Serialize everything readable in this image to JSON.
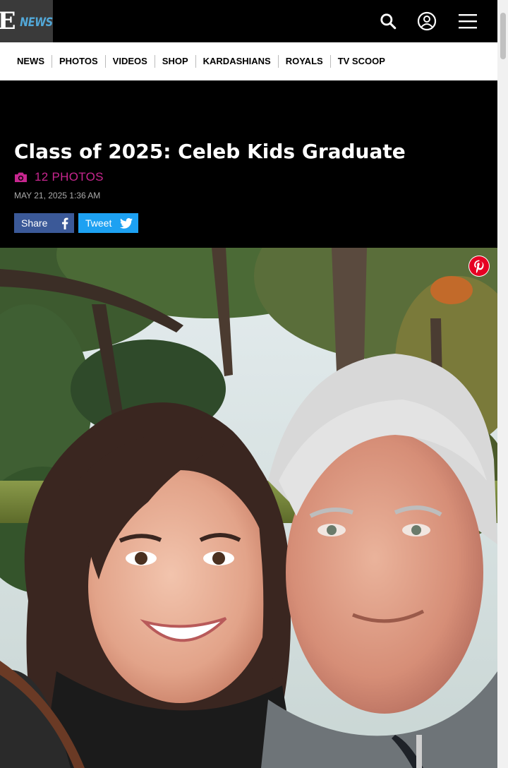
{
  "header": {
    "logo_e": "E",
    "logo_news": "NEWS"
  },
  "nav": {
    "items": [
      "NEWS",
      "PHOTOS",
      "VIDEOS",
      "SHOP",
      "KARDASHIANS",
      "ROYALS",
      "TV SCOOP"
    ]
  },
  "gallery": {
    "title": "Class of 2025: Celeb Kids Graduate",
    "photo_count": "12 PHOTOS",
    "date": "MAY 21, 2025 1:36 AM",
    "share_label": "Share",
    "tweet_label": "Tweet"
  },
  "colors": {
    "accent": "#c8268f",
    "facebook": "#3b5998",
    "twitter": "#1da1f2",
    "pinterest": "#e60023"
  },
  "icons": [
    "search-icon",
    "account-icon",
    "hamburger-menu-icon",
    "camera-icon",
    "facebook-icon",
    "twitter-icon",
    "pinterest-icon"
  ]
}
